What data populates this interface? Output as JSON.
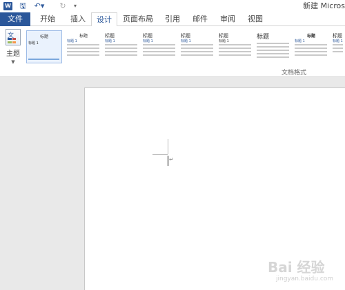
{
  "titlebar": {
    "app_icon": "W",
    "save_icon": "save-icon",
    "undo_icon": "undo-icon",
    "redo_icon": "redo-icon",
    "doc_title": "新建 Micros"
  },
  "tabs": [
    {
      "label": "文件"
    },
    {
      "label": "开始"
    },
    {
      "label": "插入"
    },
    {
      "label": "设计"
    },
    {
      "label": "页面布局"
    },
    {
      "label": "引用"
    },
    {
      "label": "邮件"
    },
    {
      "label": "审阅"
    },
    {
      "label": "视图"
    }
  ],
  "ribbon": {
    "theme_label": "主题",
    "theme_icon_text": "文",
    "group_label": "文档格式",
    "styles": [
      {
        "heading": "标题",
        "sub": "标题 1"
      },
      {
        "heading": "标题",
        "sub": "标题 1"
      },
      {
        "heading": "标题",
        "sub": "标题 1"
      },
      {
        "heading": "标题",
        "sub": "标题 1"
      },
      {
        "heading": "标题",
        "sub": "标题 1"
      },
      {
        "heading": "标题",
        "sub": "标题 1"
      },
      {
        "heading": "标题",
        "sub": ""
      },
      {
        "heading": "标题",
        "sub": "标题 1"
      },
      {
        "heading": "标题",
        "sub": "标题 1"
      }
    ]
  },
  "watermark": {
    "brand": "Bai 经验",
    "url": "jingyan.baidu.com"
  },
  "colors": {
    "accent": "#2b579a"
  }
}
